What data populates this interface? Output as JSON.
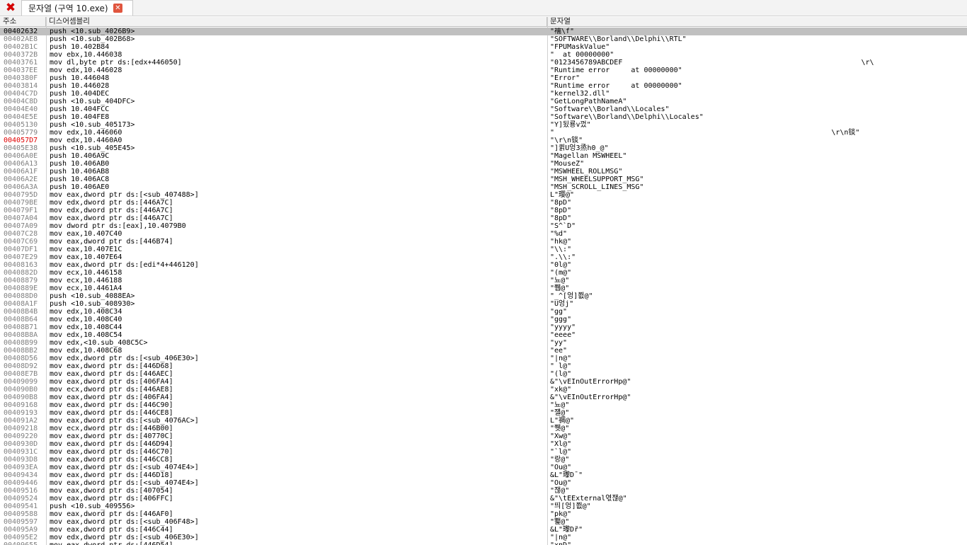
{
  "window": {
    "tab_label": "문자열 (구역 10.exe)",
    "close_icon_glyph": "✖",
    "tab_close_glyph": "✕"
  },
  "columns": {
    "address": "주소",
    "disassembly": "디스어셈블리",
    "string": "문자열"
  },
  "rows": [
    {
      "addr": "00402632",
      "disasm": "push <10.sub_4026B9>",
      "str": "\"襦\\f\"",
      "selected": true
    },
    {
      "addr": "00402AE8",
      "disasm": "push <10.sub_402B68>",
      "str": "\"SOFTWARE\\\\Borland\\\\Delphi\\\\RTL\""
    },
    {
      "addr": "00402B1C",
      "disasm": "push 10.402B84",
      "str": "\"FPUMaskValue\""
    },
    {
      "addr": "0040372B",
      "disasm": "mov ebx,10.446038",
      "str": "\"  at 00000000\""
    },
    {
      "addr": "00403761",
      "disasm": "mov dl,byte ptr ds:[edx+446050]",
      "str": "\"0123456789ABCDEF                                                        \\r\\"
    },
    {
      "addr": "004037EE",
      "disasm": "mov edx,10.446028",
      "str": "\"Runtime error     at 00000000\""
    },
    {
      "addr": "0040380F",
      "disasm": "push 10.446048",
      "str": "\"Error\""
    },
    {
      "addr": "00403814",
      "disasm": "push 10.446028",
      "str": "\"Runtime error     at 00000000\""
    },
    {
      "addr": "00404C7D",
      "disasm": "push 10.404DEC",
      "str": "\"kernel32.dll\""
    },
    {
      "addr": "00404C8D",
      "disasm": "push <10.sub_404DFC>",
      "str": "\"GetLongPathNameA\""
    },
    {
      "addr": "00404E40",
      "disasm": "push 10.404FCC",
      "str": "\"Software\\\\Borland\\\\Locales\""
    },
    {
      "addr": "00404E5E",
      "disasm": "push 10.404FE8",
      "str": "\"Software\\\\Borland\\\\Delphi\\\\Locales\""
    },
    {
      "addr": "00405130",
      "disasm": "push <10.sub_405173>",
      "str": "\"Y]됬룡v껐\""
    },
    {
      "addr": "00405779",
      "disasm": "mov edx,10.446060",
      "str": "\"                                                                 \\r\\n锬\""
    },
    {
      "addr": "004057D7",
      "disasm": "mov edx,10.4460A0",
      "str": "\"\\r\\n锬\"",
      "red": true
    },
    {
      "addr": "00405E38",
      "disasm": "push <10.sub_405E45>",
      "str": "\"]퀽U엉3烝h0_@\""
    },
    {
      "addr": "00406A0E",
      "disasm": "push 10.406A9C",
      "str": "\"Magellan MSWHEEL\""
    },
    {
      "addr": "00406A13",
      "disasm": "push 10.406AB0",
      "str": "\"MouseZ\""
    },
    {
      "addr": "00406A1F",
      "disasm": "push 10.406AB8",
      "str": "\"MSWHEEL_ROLLMSG\""
    },
    {
      "addr": "00406A2E",
      "disasm": "push 10.406AC8",
      "str": "\"MSH_WHEELSUPPORT_MSG\""
    },
    {
      "addr": "00406A3A",
      "disasm": "push 10.406AE0",
      "str": "\"MSH_SCROLL_LINES_MSG\""
    },
    {
      "addr": "0040795D",
      "disasm": "mov eax,dword ptr ds:[<sub_407488>]",
      "str": "L\"璎@\""
    },
    {
      "addr": "004079BE",
      "disasm": "mov edx,dword ptr ds:[446A7C]",
      "str": "\"8pD\""
    },
    {
      "addr": "004079F1",
      "disasm": "mov edx,dword ptr ds:[446A7C]",
      "str": "\"8pD\""
    },
    {
      "addr": "00407A04",
      "disasm": "mov eax,dword ptr ds:[446A7C]",
      "str": "\"8pD\""
    },
    {
      "addr": "00407A09",
      "disasm": "mov dword ptr ds:[eax],10.4079B0",
      "str": "\"S^`D\""
    },
    {
      "addr": "00407C28",
      "disasm": "mov eax,10.407C40",
      "str": "\"%d\""
    },
    {
      "addr": "00407C69",
      "disasm": "mov eax,dword ptr ds:[446B74]",
      "str": "\"hk@\""
    },
    {
      "addr": "00407DF1",
      "disasm": "mov eax,10.407E1C",
      "str": "\"\\\\:\""
    },
    {
      "addr": "00407E29",
      "disasm": "mov eax,10.407E64",
      "str": "\".\\\\:\""
    },
    {
      "addr": "00408163",
      "disasm": "mov eax,dword ptr ds:[edi*4+446120]",
      "str": "\"0l@\""
    },
    {
      "addr": "0040882D",
      "disasm": "mov ecx,10.446158",
      "str": "\"(m@\""
    },
    {
      "addr": "00408879",
      "disasm": "mov ecx,10.446188",
      "str": "\"뇨@\""
    },
    {
      "addr": "0040889E",
      "disasm": "mov ecx,10.4461A4",
      "str": "\"쮑@\""
    },
    {
      "addr": "004088D0",
      "disasm": "push <10.sub_4088EA>",
      "str": "\"_^[엉]쬢@\""
    },
    {
      "addr": "00408A1F",
      "disasm": "push <10.sub_408930>",
      "str": "\"U엉j\""
    },
    {
      "addr": "00408B4B",
      "disasm": "mov edx,10.408C34",
      "str": "\"gg\""
    },
    {
      "addr": "00408B64",
      "disasm": "mov edx,10.408C40",
      "str": "\"ggg\""
    },
    {
      "addr": "00408B71",
      "disasm": "mov edx,10.408C44",
      "str": "\"yyyy\""
    },
    {
      "addr": "00408B8A",
      "disasm": "mov edx,10.408C54",
      "str": "\"eeee\""
    },
    {
      "addr": "00408B99",
      "disasm": "mov edx,<10.sub_408C5C>",
      "str": "\"yy\""
    },
    {
      "addr": "00408BB2",
      "disasm": "mov edx,10.408C68",
      "str": "\"ee\""
    },
    {
      "addr": "00408D56",
      "disasm": "mov edx,dword ptr ds:[<sub_406E30>]",
      "str": "\"|n@\""
    },
    {
      "addr": "00408D92",
      "disasm": "mov eax,dword ptr ds:[446D68]",
      "str": "\" l@\""
    },
    {
      "addr": "00408E7B",
      "disasm": "mov eax,dword ptr ds:[446AEC]",
      "str": "\"(l@\""
    },
    {
      "addr": "00409099",
      "disasm": "mov eax,dword ptr ds:[406FA4]",
      "str": "&\"\\vEInOutErrorHp@\""
    },
    {
      "addr": "004090B0",
      "disasm": "mov ecx,dword ptr ds:[446AE8]",
      "str": "\"xk@\""
    },
    {
      "addr": "004090B8",
      "disasm": "mov eax,dword ptr ds:[406FA4]",
      "str": "&\"\\vEInOutErrorHp@\""
    },
    {
      "addr": "00409168",
      "disasm": "mov eax,dword ptr ds:[446C90]",
      "str": "\"뇨@\""
    },
    {
      "addr": "00409193",
      "disasm": "mov eax,dword ptr ds:[446CE8]",
      "str": "\"쟬@\""
    },
    {
      "addr": "004091A2",
      "disasm": "mov eax,dword ptr ds:[<sub_4076AC>]",
      "str": "L\"禂@\""
    },
    {
      "addr": "00409218",
      "disasm": "mov ecx,dword ptr ds:[446B00]",
      "str": "\"쮓@\""
    },
    {
      "addr": "00409220",
      "disasm": "mov eax,dword ptr ds:[40770C]",
      "str": "\"Xw@\""
    },
    {
      "addr": "0040930D",
      "disasm": "mov eax,dword ptr ds:[446D94]",
      "str": "\"Xl@\""
    },
    {
      "addr": "0040931C",
      "disasm": "mov eax,dword ptr ds:[446C70]",
      "str": "\"`l@\""
    },
    {
      "addr": "004093D8",
      "disasm": "mov eax,dword ptr ds:[446CC8]",
      "str": "\"랑@\""
    },
    {
      "addr": "004093EA",
      "disasm": "mov eax,dword ptr ds:[<sub_4074E4>]",
      "str": "\"Ou@\""
    },
    {
      "addr": "00409434",
      "disasm": "mov eax,dword ptr ds:[446D18]",
      "str": "&L\"瓈D¯\""
    },
    {
      "addr": "00409446",
      "disasm": "mov eax,dword ptr ds:[<sub_4074E4>]",
      "str": "\"Ou@\""
    },
    {
      "addr": "00409516",
      "disasm": "mov eax,dword ptr ds:[407054]",
      "str": "\"잲@\""
    },
    {
      "addr": "00409524",
      "disasm": "mov eax,dword ptr ds:[406FFC]",
      "str": "&\"\\tEExternal엯잲@\""
    },
    {
      "addr": "00409541",
      "disasm": "push <10.sub_409556>",
      "str": "\"띄[엉]쬢@\""
    },
    {
      "addr": "00409588",
      "disasm": "mov eax,dword ptr ds:[446AF0]",
      "str": "\"pk@\""
    },
    {
      "addr": "00409597",
      "disasm": "mov eax,dword ptr ds:[<sub_406F48>]",
      "str": "\"뾅@\""
    },
    {
      "addr": "004095A9",
      "disasm": "mov eax,dword ptr ds:[446C44]",
      "str": "&L\"瓈Dȑ\""
    },
    {
      "addr": "004095E2",
      "disasm": "mov edx,dword ptr ds:[<sub_406E30>]",
      "str": "\"|n@\""
    },
    {
      "addr": "00409655",
      "disasm": "mov eax,dword ptr ds:[446D54]",
      "str": "\"xnD\""
    }
  ]
}
